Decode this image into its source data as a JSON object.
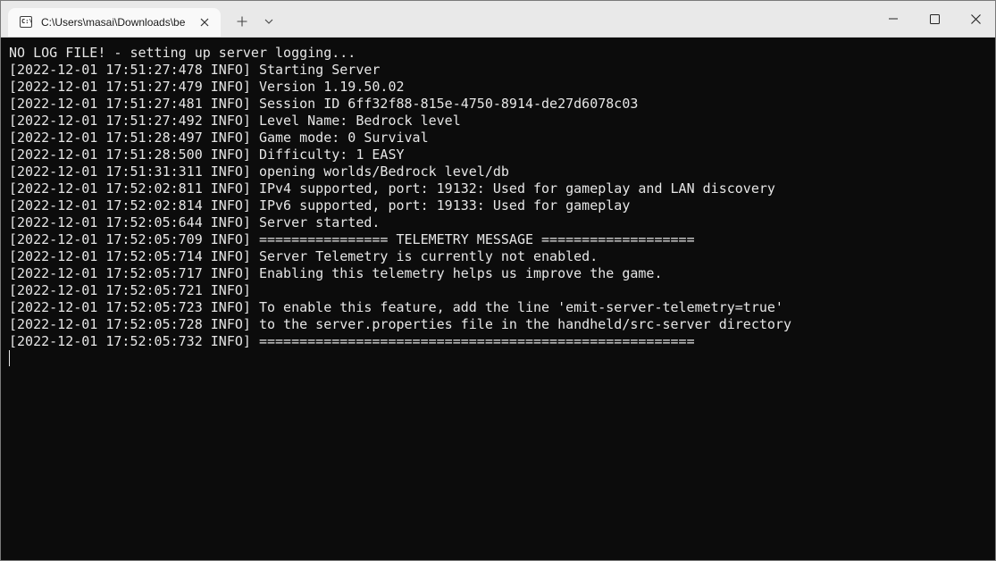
{
  "tab": {
    "title": "C:\\Users\\masai\\Downloads\\be",
    "icon": "terminal-icon",
    "icon_glyph": "C:\\"
  },
  "colors": {
    "titlebar": "#e9e9e9",
    "tab_active": "#f9f9f9",
    "terminal_bg": "#0c0c0c",
    "terminal_fg": "#e6e6e6"
  },
  "terminal": {
    "lines": [
      "NO LOG FILE! - setting up server logging...",
      "[2022-12-01 17:51:27:478 INFO] Starting Server",
      "[2022-12-01 17:51:27:479 INFO] Version 1.19.50.02",
      "[2022-12-01 17:51:27:481 INFO] Session ID 6ff32f88-815e-4750-8914-de27d6078c03",
      "[2022-12-01 17:51:27:492 INFO] Level Name: Bedrock level",
      "[2022-12-01 17:51:28:497 INFO] Game mode: 0 Survival",
      "[2022-12-01 17:51:28:500 INFO] Difficulty: 1 EASY",
      "[2022-12-01 17:51:31:311 INFO] opening worlds/Bedrock level/db",
      "[2022-12-01 17:52:02:811 INFO] IPv4 supported, port: 19132: Used for gameplay and LAN discovery",
      "[2022-12-01 17:52:02:814 INFO] IPv6 supported, port: 19133: Used for gameplay",
      "[2022-12-01 17:52:05:644 INFO] Server started.",
      "[2022-12-01 17:52:05:709 INFO] ================ TELEMETRY MESSAGE ===================",
      "[2022-12-01 17:52:05:714 INFO] Server Telemetry is currently not enabled.",
      "[2022-12-01 17:52:05:717 INFO] Enabling this telemetry helps us improve the game.",
      "[2022-12-01 17:52:05:721 INFO]",
      "[2022-12-01 17:52:05:723 INFO] To enable this feature, add the line 'emit-server-telemetry=true'",
      "[2022-12-01 17:52:05:728 INFO] to the server.properties file in the handheld/src-server directory",
      "[2022-12-01 17:52:05:732 INFO] ======================================================"
    ]
  }
}
